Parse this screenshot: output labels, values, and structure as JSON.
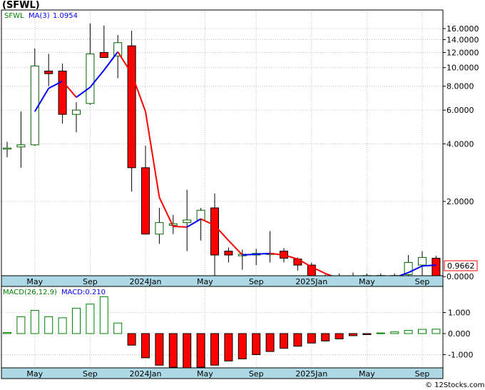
{
  "page": {
    "title": "(SFWL)",
    "copyright": "© 12Stocks.com"
  },
  "colors": {
    "up": "#ffffff",
    "down": "#ff0000",
    "wick": "#000000",
    "ma_up": "#0000ff",
    "ma_down": "#ff0000",
    "macd_pos": "#008000",
    "axis_band": "#add8e6",
    "grid": "#c0c0c0",
    "last_box": "#ff0000"
  },
  "chart_data": [
    {
      "type": "candlestick",
      "title": "(SFWL)",
      "legend": {
        "ticker": "SFWL",
        "ma_label": "MA(3)",
        "ma_value": "1.0954"
      },
      "y_scale": "log",
      "y_ticks": [
        "16.0000",
        "14.0000",
        "12.0000",
        "10.0000",
        "8.0000",
        "6.0000",
        "4.0000",
        "2.0000",
        "0.0000"
      ],
      "x_labels": [
        "May",
        "Sep",
        "2024Jan",
        "May",
        "Sep",
        "2025Jan",
        "May",
        "Sep"
      ],
      "last_value": "0.9662",
      "candles": [
        {
          "o": 3.8,
          "h": 4.1,
          "l": 3.4,
          "c": 3.8
        },
        {
          "o": 3.85,
          "h": 5.9,
          "l": 3.0,
          "c": 3.95
        },
        {
          "o": 3.95,
          "h": 12.6,
          "l": 3.9,
          "c": 10.2
        },
        {
          "o": 9.6,
          "h": 11.8,
          "l": 8.0,
          "c": 9.3
        },
        {
          "o": 9.6,
          "h": 10.5,
          "l": 5.1,
          "c": 5.7
        },
        {
          "o": 5.7,
          "h": 6.6,
          "l": 4.6,
          "c": 6.0
        },
        {
          "o": 6.5,
          "h": 17.0,
          "l": 6.4,
          "c": 11.8
        },
        {
          "o": 12.0,
          "h": 16.6,
          "l": 11.5,
          "c": 11.3
        },
        {
          "o": 11.5,
          "h": 14.8,
          "l": 8.8,
          "c": 13.5
        },
        {
          "o": 13.0,
          "h": 15.6,
          "l": 2.25,
          "c": 3.0
        },
        {
          "o": 3.0,
          "h": 3.9,
          "l": 1.35,
          "c": 1.35
        },
        {
          "o": 1.35,
          "h": 1.85,
          "l": 1.2,
          "c": 1.55
        },
        {
          "o": 1.5,
          "h": 1.7,
          "l": 1.35,
          "c": 1.53
        },
        {
          "o": 1.55,
          "h": 2.3,
          "l": 1.1,
          "c": 1.6
        },
        {
          "o": 1.6,
          "h": 1.85,
          "l": 1.25,
          "c": 1.8
        },
        {
          "o": 1.85,
          "h": 2.2,
          "l": 0.55,
          "c": 1.05
        },
        {
          "o": 1.1,
          "h": 1.15,
          "l": 0.96,
          "c": 1.05
        },
        {
          "o": 1.04,
          "h": 1.12,
          "l": 0.88,
          "c": 1.06
        },
        {
          "o": 1.05,
          "h": 1.13,
          "l": 0.93,
          "c": 1.07
        },
        {
          "o": 1.06,
          "h": 1.4,
          "l": 0.96,
          "c": 1.07
        },
        {
          "o": 1.1,
          "h": 1.14,
          "l": 0.96,
          "c": 1.01
        },
        {
          "o": 1.0,
          "h": 1.02,
          "l": 0.87,
          "c": 0.93
        },
        {
          "o": 0.93,
          "h": 0.96,
          "l": 0.79,
          "c": 0.8
        },
        {
          "o": 0.8,
          "h": 0.83,
          "l": 0.77,
          "c": 0.79
        },
        {
          "o": 0.79,
          "h": 0.84,
          "l": 0.76,
          "c": 0.805
        },
        {
          "o": 0.8,
          "h": 0.85,
          "l": 0.72,
          "c": 0.81
        },
        {
          "o": 0.81,
          "h": 0.84,
          "l": 0.74,
          "c": 0.82
        },
        {
          "o": 0.82,
          "h": 0.84,
          "l": 0.76,
          "c": 0.81
        },
        {
          "o": 0.82,
          "h": 0.84,
          "l": 0.76,
          "c": 0.79
        },
        {
          "o": 0.83,
          "h": 1.05,
          "l": 0.8,
          "c": 0.96
        },
        {
          "o": 0.93,
          "h": 1.1,
          "l": 0.81,
          "c": 1.02
        },
        {
          "o": 1.01,
          "h": 1.04,
          "l": 0.75,
          "c": 0.79
        }
      ],
      "ma": [
        null,
        null,
        5.9,
        7.8,
        8.5,
        7.0,
        7.9,
        9.7,
        12.1,
        9.3,
        5.9,
        2.1,
        1.48,
        1.47,
        1.62,
        1.5,
        1.25,
        1.05,
        1.06,
        1.07,
        1.05,
        1.0,
        0.91,
        0.84,
        0.79,
        0.8,
        0.81,
        0.81,
        0.8,
        0.85,
        0.92,
        0.93
      ]
    },
    {
      "type": "bar",
      "title": "MACD(26,12,9)",
      "legend": {
        "label": "MACD(26,12,9)",
        "value_label": "MACD:0.210"
      },
      "y_ticks": [
        "1.000",
        "0.000",
        "-1.000"
      ],
      "ylim": [
        -1.65,
        2.1
      ],
      "x_labels": [
        "May",
        "Sep",
        "2024Jan",
        "May",
        "Sep",
        "2025Jan",
        "May",
        "Sep"
      ],
      "values": [
        0.05,
        0.8,
        1.1,
        0.8,
        0.75,
        1.2,
        1.4,
        1.75,
        0.5,
        -0.55,
        -1.15,
        -1.5,
        -1.6,
        -1.65,
        -1.6,
        -1.5,
        -1.3,
        -1.2,
        -1.0,
        -0.85,
        -0.7,
        -0.6,
        -0.45,
        -0.35,
        -0.25,
        -0.1,
        -0.05,
        0.03,
        0.08,
        0.15,
        0.2,
        0.21
      ]
    }
  ]
}
